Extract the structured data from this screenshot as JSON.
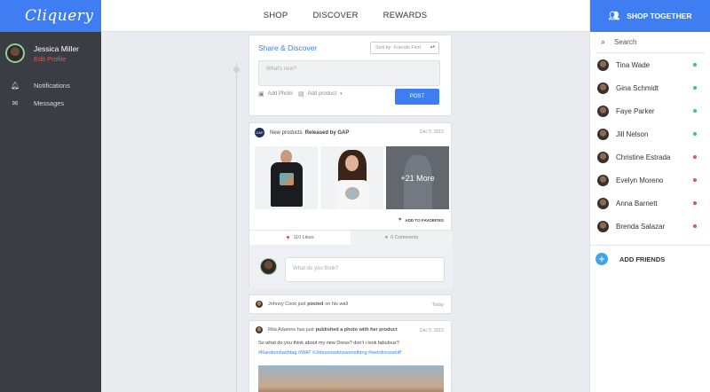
{
  "brand": "Cliquery",
  "user": {
    "name": "Jessica Miller",
    "edit_label": "Edit Profile"
  },
  "left_nav": [
    {
      "label": "Notifications",
      "icon": "bell-icon"
    },
    {
      "label": "Messages",
      "icon": "envelope-icon"
    }
  ],
  "top_nav": [
    "SHOP",
    "DISCOVER",
    "REWARDS"
  ],
  "right_panel": {
    "shop_together": "SHOP TOGETHER",
    "search_placeholder": "Search",
    "friends": [
      {
        "name": "Tina Wade",
        "status": "online"
      },
      {
        "name": "Gina Schmidt",
        "status": "online"
      },
      {
        "name": "Faye Parker",
        "status": "online"
      },
      {
        "name": "Jill Nelson",
        "status": "online"
      },
      {
        "name": "Christine Estrada",
        "status": "offline"
      },
      {
        "name": "Evelyn Moreno",
        "status": "offline"
      },
      {
        "name": "Anna Barnett",
        "status": "offline"
      },
      {
        "name": "Brenda Salazar",
        "status": "offline"
      }
    ],
    "add_friends": "ADD FRIENDS"
  },
  "share": {
    "title": "Share & Discover",
    "sort": "Sort by: Friends First",
    "placeholder": "What's new?",
    "add_photo": "Add Photo",
    "add_product": "Add product",
    "post": "POST"
  },
  "product_post": {
    "prefix": "New products",
    "suffix": "Released by GAP",
    "logo": "GAP",
    "date": "Dec 5, 2015",
    "more": "+21 More",
    "favorites": "ADD TO FAVORITES",
    "likes": "110 Likes",
    "comments": "0 Comments",
    "comment_placeholder": "What do you think?"
  },
  "johnny_post": {
    "name": "Johnny Cook",
    "mid": "just",
    "verb": "posted",
    "rest": "on his wall",
    "date": "Today"
  },
  "rita_post": {
    "name": "Rita Adamns",
    "mid": "has just",
    "verb": "published a photo with her product",
    "date": "Dec 5, 2015",
    "message": "So what do you think about my new Dress? don't i look fabulous?",
    "tags": "#Randomhashtag #WAT #Johnsnowknowsnothing #weirdressstuff"
  },
  "colors": {
    "accent": "#3f7ef2",
    "online": "#3ec46d",
    "offline": "#e5534b"
  }
}
